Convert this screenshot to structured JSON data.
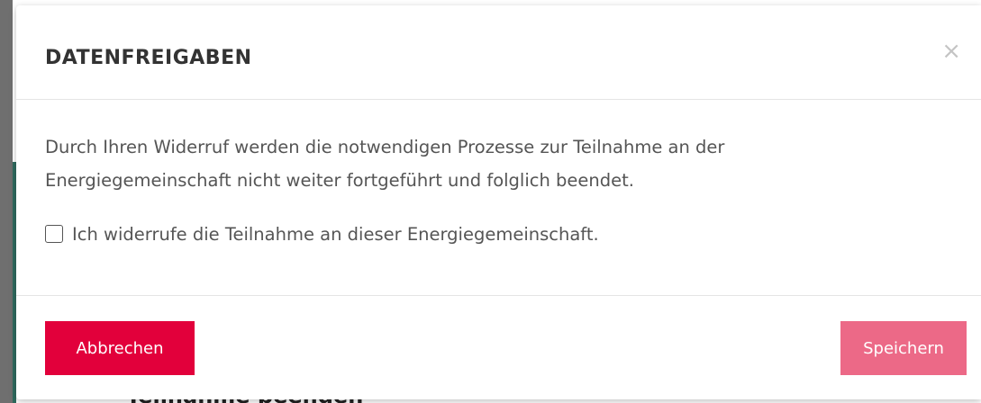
{
  "background": {
    "partial_text": "Teilnahme beenden"
  },
  "modal": {
    "title": "DATENFREIGABEN",
    "close_symbol": "×",
    "body_text": "Durch Ihren Widerruf werden die notwendigen Prozesse zur Teilnahme an der Energiegemeinschaft nicht weiter fortgeführt und folglich beendet.",
    "checkbox": {
      "label": "Ich widerrufe die Teilnahme an dieser Energiegemeinschaft.",
      "checked": false
    },
    "buttons": {
      "cancel_label": "Abbrechen",
      "save_label": "Speichern"
    }
  },
  "colors": {
    "primary": "#e2003b",
    "primary_disabled": "#ec6987"
  }
}
